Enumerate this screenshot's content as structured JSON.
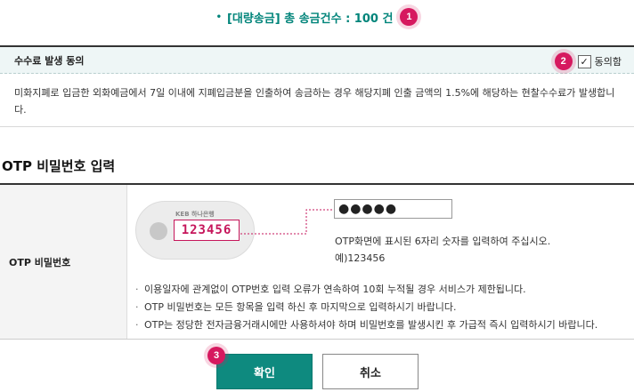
{
  "summary": {
    "text": "[대량송금] 총 송금건수 : 100 건",
    "bullet": "•",
    "badge": "1"
  },
  "fee_consent": {
    "title": "수수료 발생 동의",
    "badge": "2",
    "checkbox_checked": true,
    "checkbox_mark": "✓",
    "checkbox_label": "동의함",
    "body": "미화지폐로 입금한 외화예금에서 7일 이내에 지폐입금분을 인출하여 송금하는 경우 해당지폐 인출 금액의 1.5%에 해당하는 현찰수수료가 발생합니다."
  },
  "otp": {
    "section_title": "OTP 비밀번호 입력",
    "row_label": "OTP 비밀번호",
    "device_logo": "KEB 하나은행",
    "device_code": "123456",
    "input_value": "●●●●●",
    "help_line1": "OTP화면에 표시된 6자리 숫자를 입력하여 주십시오.",
    "help_line2": "예)123456",
    "notes": [
      "이용일자에 관계없이 OTP번호 입력 오류가 연속하여 10회 누적될 경우 서비스가 제한됩니다.",
      "OTP 비밀번호는 모든 항목을 입력 하신 후 마지막으로 입력하시기 바랍니다.",
      "OTP는 정당한 전자금융거래시에만 사용하셔야 하며 비밀번호를 발생시킨 후 가급적 즉시 입력하시기 바랍니다."
    ]
  },
  "buttons": {
    "confirm": "확인",
    "cancel": "취소",
    "badge": "3"
  },
  "colors": {
    "accent": "#0e8a7f",
    "badge": "#d6195f",
    "header_bg": "#eef6f6"
  }
}
